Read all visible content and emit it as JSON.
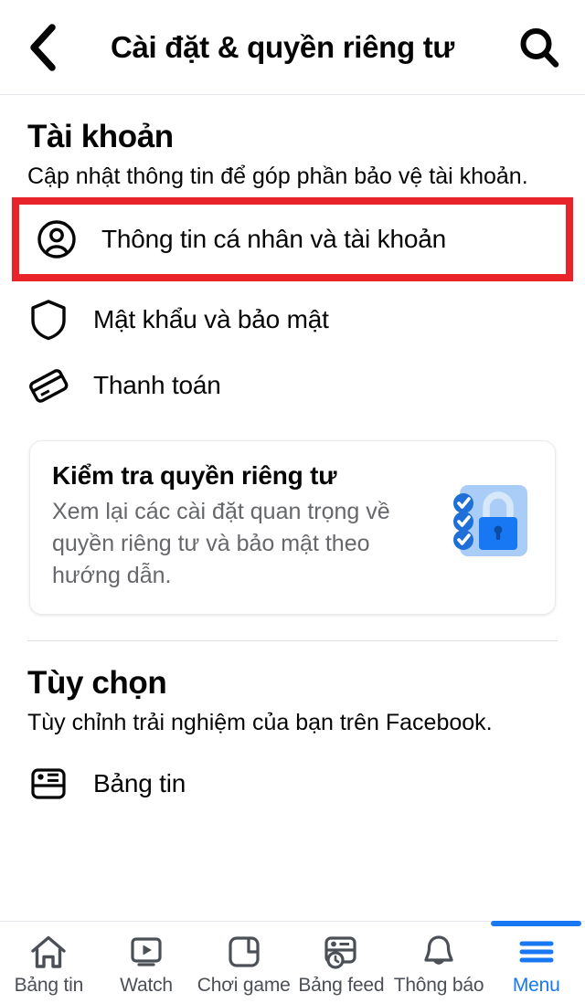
{
  "header": {
    "title": "Cài đặt & quyền riêng tư",
    "back_icon": "chevron-left-icon",
    "search_icon": "search-icon"
  },
  "sections": [
    {
      "title": "Tài khoản",
      "description": "Cập nhật thông tin để góp phần bảo vệ tài khoản.",
      "rows": [
        {
          "label": "Thông tin cá nhân và tài khoản",
          "icon": "person-circle-icon",
          "highlighted": true
        },
        {
          "label": "Mật khẩu và bảo mật",
          "icon": "shield-icon",
          "highlighted": false
        },
        {
          "label": "Thanh toán",
          "icon": "credit-card-icon",
          "highlighted": false
        }
      ],
      "card": {
        "title": "Kiểm tra quyền riêng tư",
        "description": "Xem lại các cài đặt quan trọng về quyền riêng tư và bảo mật theo hướng dẫn.",
        "art_icon": "privacy-checkup-lock-icon"
      }
    },
    {
      "title": "Tùy chọn",
      "description": "Tùy chỉnh trải nghiệm của bạn trên Facebook.",
      "rows": [
        {
          "label": "Bảng tin",
          "icon": "news-feed-icon",
          "highlighted": false
        }
      ]
    }
  ],
  "bottom_nav": {
    "items": [
      {
        "label": "Bảng tin",
        "icon": "home-icon",
        "active": false
      },
      {
        "label": "Watch",
        "icon": "play-video-icon",
        "active": false
      },
      {
        "label": "Chơi game",
        "icon": "gaming-icon",
        "active": false
      },
      {
        "label": "Bảng feed",
        "icon": "feeds-clock-icon",
        "active": false
      },
      {
        "label": "Thông báo",
        "icon": "bell-icon",
        "active": false
      },
      {
        "label": "Menu",
        "icon": "hamburger-menu-icon",
        "active": true
      }
    ]
  },
  "colors": {
    "highlight_red": "#e8232a",
    "accent_blue": "#1877f2",
    "text_primary": "#050505",
    "text_secondary": "#65676b"
  }
}
